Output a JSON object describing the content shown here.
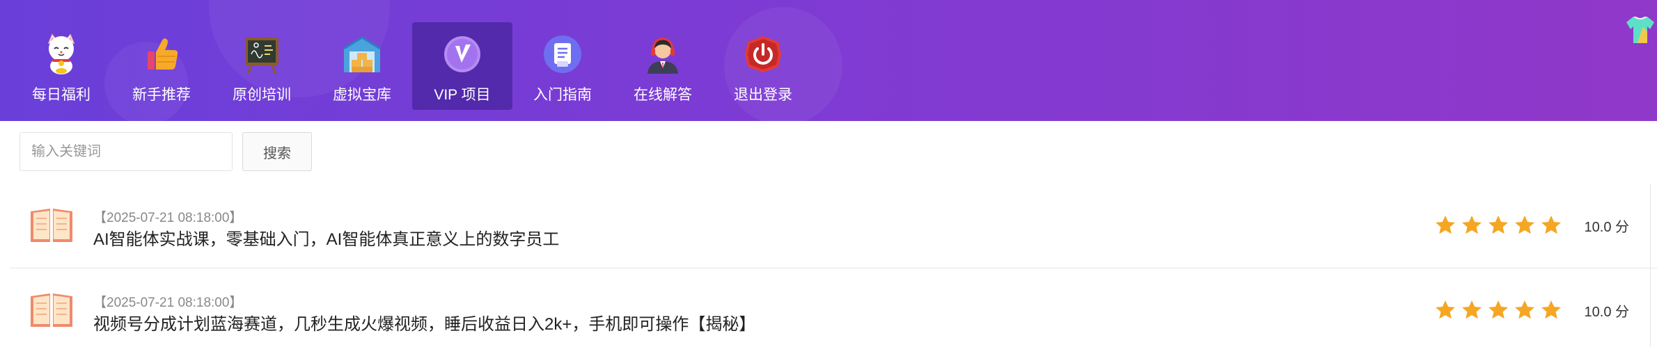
{
  "nav": {
    "items": [
      {
        "label": "每日福利",
        "icon": "lucky-cat-icon"
      },
      {
        "label": "新手推荐",
        "icon": "thumbs-up-icon"
      },
      {
        "label": "原创培训",
        "icon": "chalkboard-icon"
      },
      {
        "label": "虚拟宝库",
        "icon": "warehouse-icon"
      },
      {
        "label": "VIP 项目",
        "icon": "vip-badge-icon",
        "active": true
      },
      {
        "label": "入门指南",
        "icon": "document-icon"
      },
      {
        "label": "在线解答",
        "icon": "support-agent-icon"
      },
      {
        "label": "退出登录",
        "icon": "power-icon"
      }
    ]
  },
  "corner": {
    "icon": "shirt-icon"
  },
  "search": {
    "placeholder": "输入关键词",
    "button_label": "搜索"
  },
  "list": [
    {
      "date": "【2025-07-21 08:18:00】",
      "title": "AI智能体实战课，零基础入门，AI智能体真正意义上的数字员工",
      "stars": 5,
      "score": "10.0 分",
      "icon": "open-book-icon"
    },
    {
      "date": "【2025-07-21 08:18:00】",
      "title": "视频号分成计划蓝海赛道，几秒生成火爆视频，睡后收益日入2k+，手机即可操作【揭秘】",
      "stars": 5,
      "score": "10.0 分",
      "icon": "open-book-icon"
    }
  ],
  "colors": {
    "header_gradient_start": "#6a3fd9",
    "header_gradient_end": "#9038c9",
    "star": "#f5a623",
    "book": "#f08a6a"
  }
}
